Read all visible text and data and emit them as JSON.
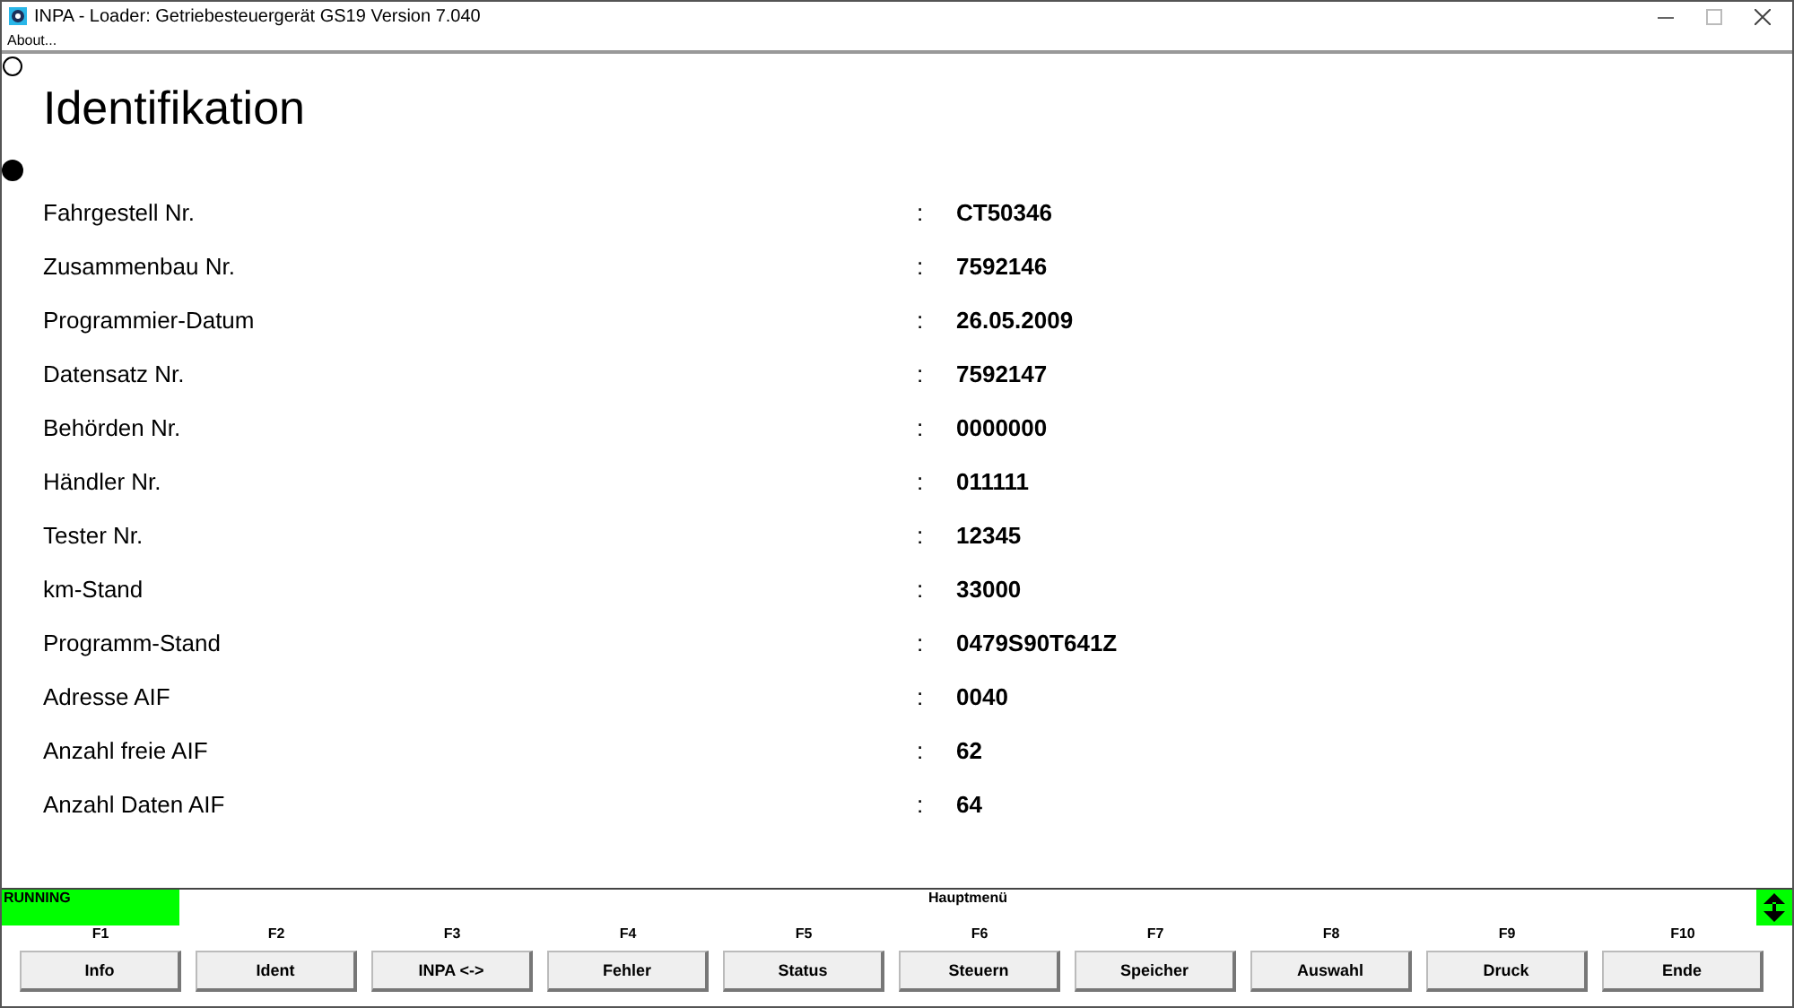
{
  "window": {
    "title": "INPA - Loader:  Getriebesteuergerät GS19 Version 7.040"
  },
  "menu": [
    "About..."
  ],
  "heading": "Identifikation",
  "fields": [
    {
      "label": "Fahrgestell Nr.",
      "separator": ":",
      "value": "CT50346"
    },
    {
      "label": "Zusammenbau Nr.",
      "separator": ":",
      "value": "7592146"
    },
    {
      "label": "Programmier-Datum",
      "separator": ":",
      "value": "26.05.2009"
    },
    {
      "label": "Datensatz Nr.",
      "separator": ":",
      "value": "7592147"
    },
    {
      "label": "Behörden Nr.",
      "separator": ":",
      "value": "0000000"
    },
    {
      "label": "Händler Nr.",
      "separator": ":",
      "value": "011111"
    },
    {
      "label": "Tester Nr.",
      "separator": ":",
      "value": "12345"
    },
    {
      "label": "km-Stand",
      "separator": ":",
      "value": "33000"
    },
    {
      "label": "Programm-Stand",
      "separator": ":",
      "value": "0479S90T641Z"
    },
    {
      "label": "Adresse AIF",
      "separator": ":",
      "value": "0040"
    },
    {
      "label": "Anzahl freie AIF",
      "separator": ":",
      "value": "62"
    },
    {
      "label": "Anzahl Daten AIF",
      "separator": ":",
      "value": "64"
    }
  ],
  "status_bar": {
    "state": "RUNNING",
    "menu_title": "Hauptmenü"
  },
  "function_keys": [
    {
      "key": "F1",
      "label": "Info"
    },
    {
      "key": "F2",
      "label": "Ident"
    },
    {
      "key": "F3",
      "label": "INPA <->"
    },
    {
      "key": "F4",
      "label": "Fehler"
    },
    {
      "key": "F5",
      "label": "Status"
    },
    {
      "key": "F6",
      "label": "Steuern"
    },
    {
      "key": "F7",
      "label": "Speicher"
    },
    {
      "key": "F8",
      "label": "Auswahl"
    },
    {
      "key": "F9",
      "label": "Druck"
    },
    {
      "key": "F10",
      "label": "Ende"
    }
  ]
}
